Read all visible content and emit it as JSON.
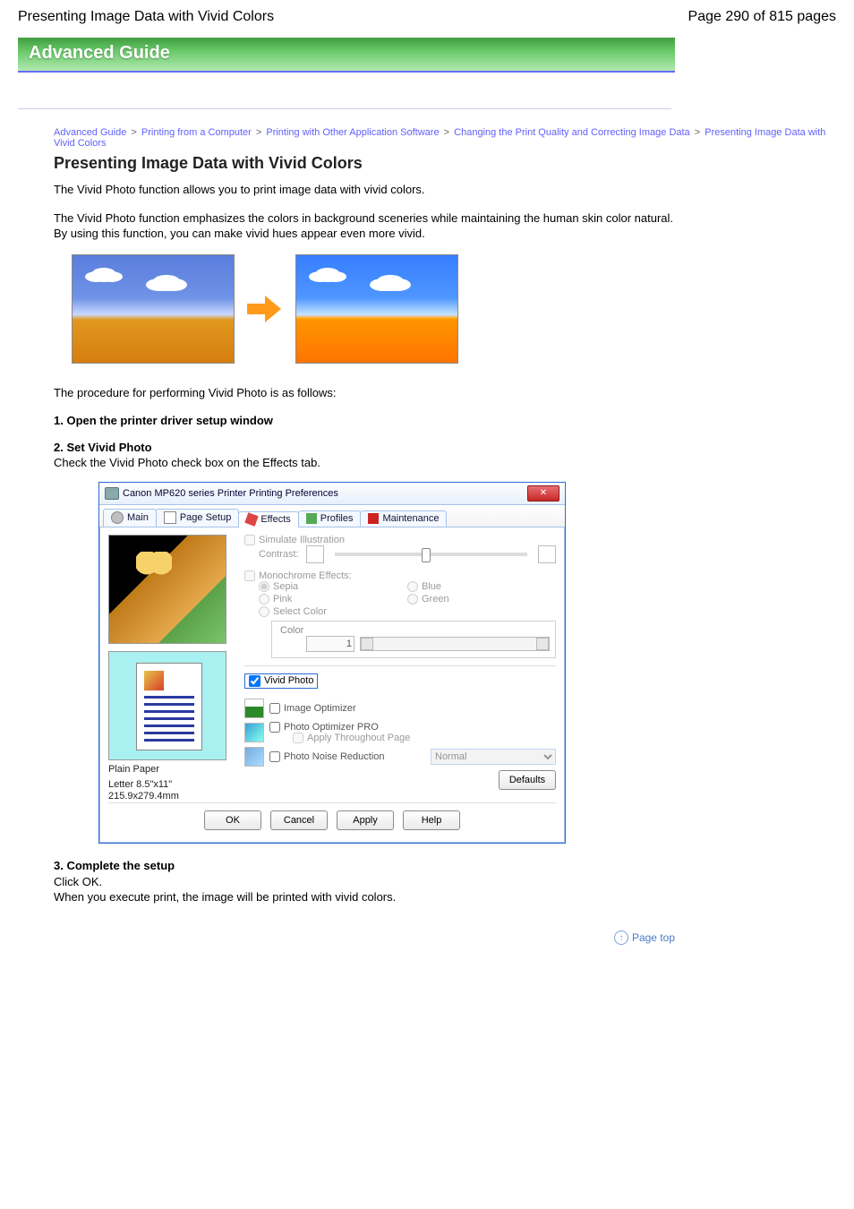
{
  "header": {
    "title": "Presenting Image Data with Vivid Colors",
    "page_counter": "Page 290 of 815 pages"
  },
  "band": "Advanced Guide",
  "breadcrumb": {
    "a": "Advanced Guide",
    "b": "Printing from a Computer",
    "c": "Printing with Other Application Software",
    "d": "Changing the Print Quality and Correcting Image Data",
    "e": "Presenting Image Data with Vivid Colors",
    "sep": ">"
  },
  "h2": "Presenting Image Data with Vivid Colors",
  "intro1": "The Vivid Photo function allows you to print image data with vivid colors.",
  "intro2": "The Vivid Photo function emphasizes the colors in background sceneries while maintaining the human skin color natural. By using this function, you can make vivid hues appear even more vivid.",
  "proc_intro": "The procedure for performing Vivid Photo is as follows:",
  "step1_num": "1.",
  "step1_title": "Open the printer driver setup window",
  "step2_num": "2.",
  "step2_title": "Set Vivid Photo",
  "step2_body": "Check the Vivid Photo check box on the Effects tab.",
  "step3_num": "3.",
  "step3_title": "Complete the setup",
  "step3_body1": "Click OK.",
  "step3_body2": "When you execute print, the image will be printed with vivid colors.",
  "dialog": {
    "title": "Canon MP620 series Printer Printing Preferences",
    "tabs": {
      "main": "Main",
      "page_setup": "Page Setup",
      "effects": "Effects",
      "profiles": "Profiles",
      "maintenance": "Maintenance"
    },
    "simulate": "Simulate Illustration",
    "contrast_label": "Contrast:",
    "mono": "Monochrome Effects:",
    "sepia": "Sepia",
    "blue": "Blue",
    "pink": "Pink",
    "green": "Green",
    "select_color": "Select Color",
    "color_legend": "Color",
    "color_value": "1",
    "vivid": "Vivid Photo",
    "image_opt": "Image Optimizer",
    "pop": "Photo Optimizer PRO",
    "apply_throughout": "Apply Throughout Page",
    "noise": "Photo Noise Reduction",
    "noise_level": "Normal",
    "paper1": "Plain Paper",
    "paper2": "Letter 8.5\"x11\" 215.9x279.4mm",
    "defaults": "Defaults",
    "ok": "OK",
    "cancel": "Cancel",
    "apply": "Apply",
    "help": "Help"
  },
  "pagetop": "Page top"
}
